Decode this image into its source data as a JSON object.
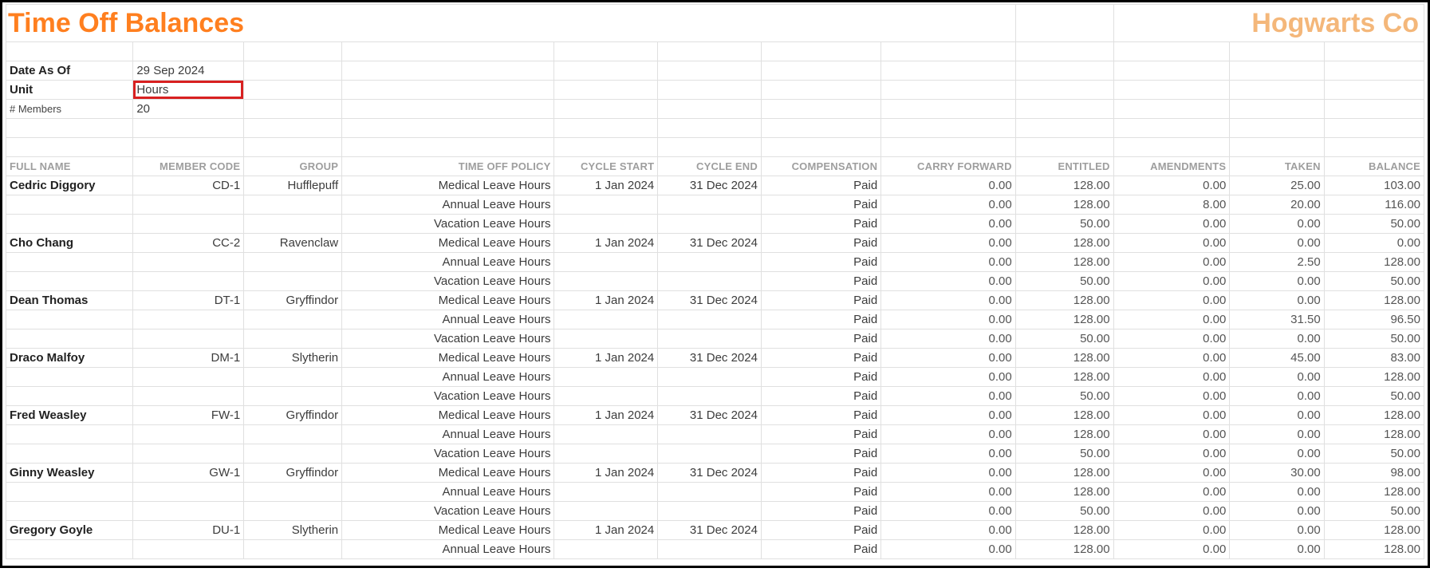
{
  "header": {
    "title": "Time Off Balances",
    "company": "Hogwarts Co",
    "date_label": "Date As Of",
    "date_value": "29 Sep 2024",
    "unit_label": "Unit",
    "unit_value": "Hours",
    "members_label": "# Members",
    "members_value": "20"
  },
  "columns": {
    "full_name": "FULL NAME",
    "member_code": "MEMBER CODE",
    "group": "GROUP",
    "policy": "TIME OFF POLICY",
    "cycle_start": "CYCLE START",
    "cycle_end": "CYCLE END",
    "compensation": "COMPENSATION",
    "carry_forward": "CARRY FORWARD",
    "entitled": "ENTITLED",
    "amendments": "AMENDMENTS",
    "taken": "TAKEN",
    "balance": "BALANCE"
  },
  "members": [
    {
      "name": "Cedric Diggory",
      "code": "CD-1",
      "group": "Hufflepuff",
      "rows": [
        {
          "policy": "Medical Leave Hours",
          "cycle_start": "1 Jan 2024",
          "cycle_end": "31 Dec 2024",
          "comp": "Paid",
          "carry": "0.00",
          "ent": "128.00",
          "amend": "0.00",
          "taken": "25.00",
          "bal": "103.00"
        },
        {
          "policy": "Annual Leave Hours",
          "cycle_start": "",
          "cycle_end": "",
          "comp": "Paid",
          "carry": "0.00",
          "ent": "128.00",
          "amend": "8.00",
          "taken": "20.00",
          "bal": "116.00"
        },
        {
          "policy": "Vacation Leave Hours",
          "cycle_start": "",
          "cycle_end": "",
          "comp": "Paid",
          "carry": "0.00",
          "ent": "50.00",
          "amend": "0.00",
          "taken": "0.00",
          "bal": "50.00"
        }
      ]
    },
    {
      "name": "Cho Chang",
      "code": "CC-2",
      "group": "Ravenclaw",
      "rows": [
        {
          "policy": "Medical Leave Hours",
          "cycle_start": "1 Jan 2024",
          "cycle_end": "31 Dec 2024",
          "comp": "Paid",
          "carry": "0.00",
          "ent": "128.00",
          "amend": "0.00",
          "taken": "0.00",
          "bal": "0.00"
        },
        {
          "policy": "Annual Leave Hours",
          "cycle_start": "",
          "cycle_end": "",
          "comp": "Paid",
          "carry": "0.00",
          "ent": "128.00",
          "amend": "0.00",
          "taken": "2.50",
          "bal": "128.00"
        },
        {
          "policy": "Vacation Leave Hours",
          "cycle_start": "",
          "cycle_end": "",
          "comp": "Paid",
          "carry": "0.00",
          "ent": "50.00",
          "amend": "0.00",
          "taken": "0.00",
          "bal": "50.00"
        }
      ]
    },
    {
      "name": "Dean Thomas",
      "code": "DT-1",
      "group": "Gryffindor",
      "rows": [
        {
          "policy": "Medical Leave Hours",
          "cycle_start": "1 Jan 2024",
          "cycle_end": "31 Dec 2024",
          "comp": "Paid",
          "carry": "0.00",
          "ent": "128.00",
          "amend": "0.00",
          "taken": "0.00",
          "bal": "128.00"
        },
        {
          "policy": "Annual Leave Hours",
          "cycle_start": "",
          "cycle_end": "",
          "comp": "Paid",
          "carry": "0.00",
          "ent": "128.00",
          "amend": "0.00",
          "taken": "31.50",
          "bal": "96.50"
        },
        {
          "policy": "Vacation Leave Hours",
          "cycle_start": "",
          "cycle_end": "",
          "comp": "Paid",
          "carry": "0.00",
          "ent": "50.00",
          "amend": "0.00",
          "taken": "0.00",
          "bal": "50.00"
        }
      ]
    },
    {
      "name": "Draco Malfoy",
      "code": "DM-1",
      "group": "Slytherin",
      "rows": [
        {
          "policy": "Medical Leave Hours",
          "cycle_start": "1 Jan 2024",
          "cycle_end": "31 Dec 2024",
          "comp": "Paid",
          "carry": "0.00",
          "ent": "128.00",
          "amend": "0.00",
          "taken": "45.00",
          "bal": "83.00"
        },
        {
          "policy": "Annual Leave Hours",
          "cycle_start": "",
          "cycle_end": "",
          "comp": "Paid",
          "carry": "0.00",
          "ent": "128.00",
          "amend": "0.00",
          "taken": "0.00",
          "bal": "128.00"
        },
        {
          "policy": "Vacation Leave Hours",
          "cycle_start": "",
          "cycle_end": "",
          "comp": "Paid",
          "carry": "0.00",
          "ent": "50.00",
          "amend": "0.00",
          "taken": "0.00",
          "bal": "50.00"
        }
      ]
    },
    {
      "name": "Fred Weasley",
      "code": "FW-1",
      "group": "Gryffindor",
      "rows": [
        {
          "policy": "Medical Leave Hours",
          "cycle_start": "1 Jan 2024",
          "cycle_end": "31 Dec 2024",
          "comp": "Paid",
          "carry": "0.00",
          "ent": "128.00",
          "amend": "0.00",
          "taken": "0.00",
          "bal": "128.00"
        },
        {
          "policy": "Annual Leave Hours",
          "cycle_start": "",
          "cycle_end": "",
          "comp": "Paid",
          "carry": "0.00",
          "ent": "128.00",
          "amend": "0.00",
          "taken": "0.00",
          "bal": "128.00"
        },
        {
          "policy": "Vacation Leave Hours",
          "cycle_start": "",
          "cycle_end": "",
          "comp": "Paid",
          "carry": "0.00",
          "ent": "50.00",
          "amend": "0.00",
          "taken": "0.00",
          "bal": "50.00"
        }
      ]
    },
    {
      "name": "Ginny Weasley",
      "code": "GW-1",
      "group": "Gryffindor",
      "rows": [
        {
          "policy": "Medical Leave Hours",
          "cycle_start": "1 Jan 2024",
          "cycle_end": "31 Dec 2024",
          "comp": "Paid",
          "carry": "0.00",
          "ent": "128.00",
          "amend": "0.00",
          "taken": "30.00",
          "bal": "98.00"
        },
        {
          "policy": "Annual Leave Hours",
          "cycle_start": "",
          "cycle_end": "",
          "comp": "Paid",
          "carry": "0.00",
          "ent": "128.00",
          "amend": "0.00",
          "taken": "0.00",
          "bal": "128.00"
        },
        {
          "policy": "Vacation Leave Hours",
          "cycle_start": "",
          "cycle_end": "",
          "comp": "Paid",
          "carry": "0.00",
          "ent": "50.00",
          "amend": "0.00",
          "taken": "0.00",
          "bal": "50.00"
        }
      ]
    },
    {
      "name": "Gregory Goyle",
      "code": "DU-1",
      "group": "Slytherin",
      "rows": [
        {
          "policy": "Medical Leave Hours",
          "cycle_start": "1 Jan 2024",
          "cycle_end": "31 Dec 2024",
          "comp": "Paid",
          "carry": "0.00",
          "ent": "128.00",
          "amend": "0.00",
          "taken": "0.00",
          "bal": "128.00"
        },
        {
          "policy": "Annual Leave Hours",
          "cycle_start": "",
          "cycle_end": "",
          "comp": "Paid",
          "carry": "0.00",
          "ent": "128.00",
          "amend": "0.00",
          "taken": "0.00",
          "bal": "128.00"
        }
      ]
    }
  ]
}
